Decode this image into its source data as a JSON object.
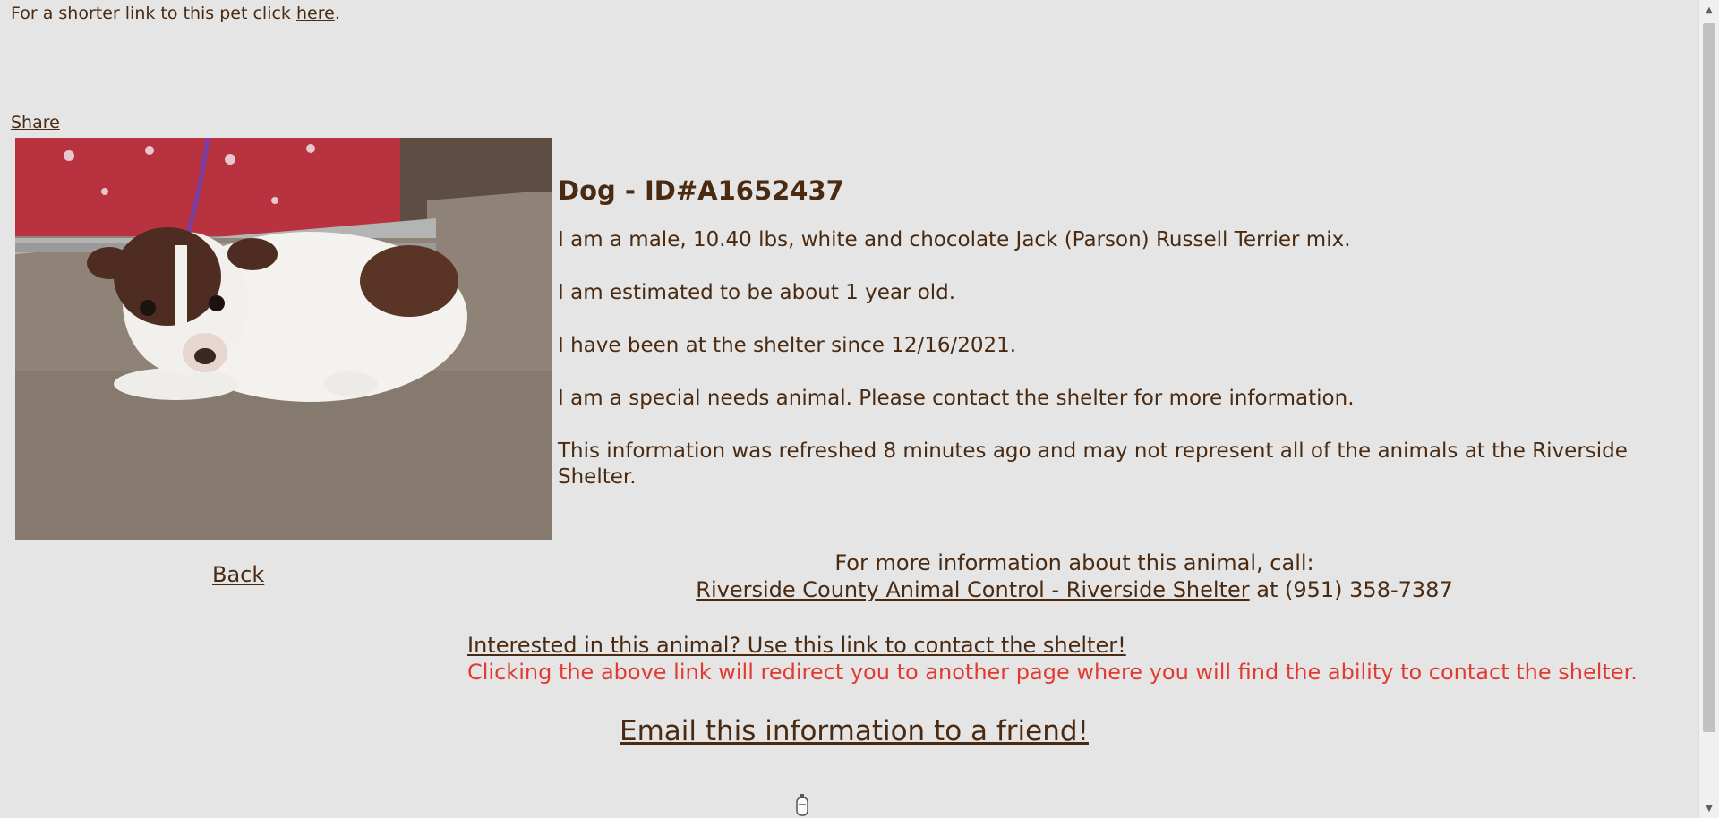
{
  "top": {
    "shorter_link_prefix": "For a shorter link to this pet click ",
    "shorter_link_label": "here",
    "shorter_link_suffix": ".",
    "share_label": "Share"
  },
  "animal": {
    "title": "Dog - ID#A1652437",
    "description": "I am a male, 10.40 lbs, white and chocolate Jack (Parson) Russell Terrier mix.",
    "age": "I am estimated to be about 1 year old.",
    "since": "I have been at the shelter since 12/16/2021.",
    "special_needs": "I am a special needs animal. Please contact the shelter for more information.",
    "refresh_note": "This information was refreshed 8 minutes ago and may not represent all of the animals at the Riverside Shelter."
  },
  "nav": {
    "back_label": "Back"
  },
  "contact": {
    "intro": "For more information about this animal, call:",
    "shelter_link": "Riverside County Animal Control - Riverside Shelter",
    "at_phone": " at (951) 358-7387",
    "interested_link": "Interested in this animal? Use this link to contact the shelter!",
    "redirect_note": "Clicking the above link will redirect you to another page where you will find the ability to contact the shelter.",
    "email_link": "Email this information to a friend!"
  },
  "colors": {
    "background": "#e5e5e5",
    "text": "#4a2a10",
    "note_red": "#e23a30"
  },
  "icons": {
    "photo": "dog-photo",
    "loading": "spinner-icon",
    "scroll_up": "chevron-up-icon",
    "scroll_down": "chevron-down-icon"
  }
}
